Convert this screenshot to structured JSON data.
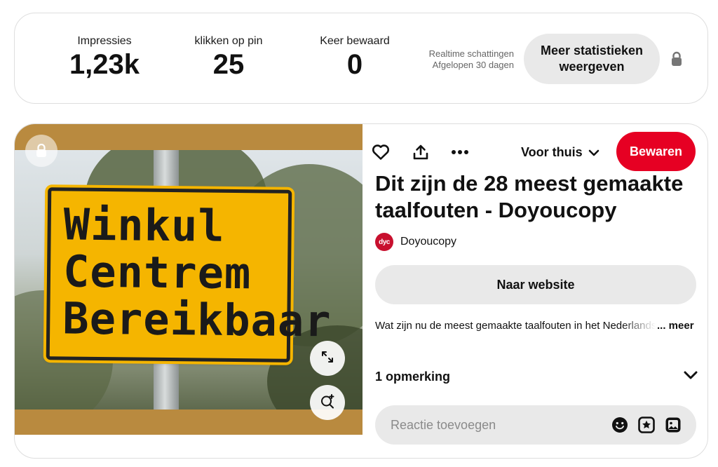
{
  "stats": {
    "items": [
      {
        "label": "Impressies",
        "value": "1,23k"
      },
      {
        "label": "klikken op pin",
        "value": "25"
      },
      {
        "label": "Keer bewaard",
        "value": "0"
      }
    ],
    "realtime_line1": "Realtime schattingen",
    "realtime_line2": "Afgelopen 30 dagen",
    "more_button": "Meer statistieken weergeven",
    "lock_icon": "lock-icon"
  },
  "pin": {
    "image": {
      "sign_lines": [
        "Winkul",
        "Centrem",
        "Bereikbaar"
      ],
      "sign_color": "#f5b500",
      "frame_color": "#b98a3f"
    },
    "toolbar": {
      "heart_icon": "heart-icon",
      "share_icon": "share-icon",
      "more_icon": "more-dots-icon",
      "board": "Voor thuis",
      "save_label": "Bewaren",
      "save_color": "#e60023"
    },
    "title": "Dit zijn de 28 meest gemaakte taalfouten - Doyoucopy",
    "creator": {
      "avatar_text": "dyc",
      "name": "Doyoucopy"
    },
    "website_button": "Naar website",
    "description": "Wat zijn nu de meest gemaakte taalfouten in het Nederlands",
    "description_more": "... meer",
    "comments": {
      "label": "1 opmerking"
    },
    "reply": {
      "placeholder": "Reactie toevoegen"
    }
  }
}
